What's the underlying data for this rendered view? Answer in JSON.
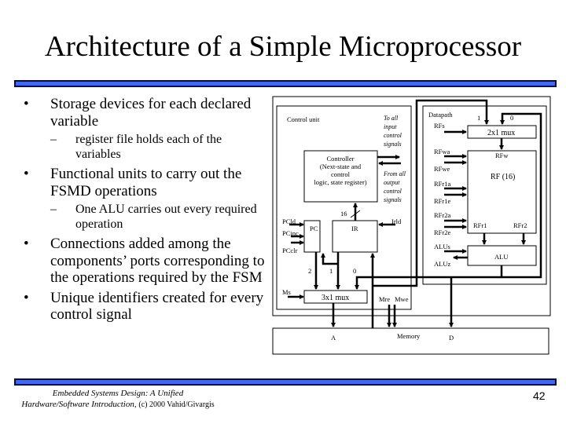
{
  "slide": {
    "title": "Architecture of a Simple Microprocessor",
    "page_number": "42",
    "footer": {
      "line1": "Embedded Systems Design: A Unified",
      "line2_italic": "Hardware/Software Introduction,",
      "line2_plain": "(c) 2000 Vahid/Givargis"
    },
    "accent_color": "#3f69f2"
  },
  "bullets": [
    {
      "level": 1,
      "marker": "•",
      "text": "Storage devices for each declared variable"
    },
    {
      "level": 2,
      "marker": "–",
      "text": "register file holds each of the variables"
    },
    {
      "level": 1,
      "marker": "•",
      "text": "Functional units to carry out the FSMD operations"
    },
    {
      "level": 2,
      "marker": "–",
      "text": "One ALU carries out every required operation"
    },
    {
      "level": 1,
      "marker": "•",
      "text": "Connections added among the components’ ports corresponding to the operations required by the FSM"
    },
    {
      "level": 1,
      "marker": "•",
      "text": "Unique identifiers created for every control signal"
    }
  ],
  "diagram": {
    "control_unit": {
      "label": "Control unit",
      "controller": [
        "Controller",
        "(Next-state and",
        "control",
        "logic, state register)"
      ],
      "to_inputs": [
        "To all",
        "input",
        "control",
        "signals"
      ],
      "from_outputs": [
        "From all",
        "output",
        "control",
        "signals"
      ],
      "bus_width": "16",
      "pc": "PC",
      "ir": "IR",
      "pc_signals": [
        "PCld",
        "PCinc",
        "PCclr"
      ],
      "ir_signal": "Irld",
      "mux3": "3x1 mux",
      "mux3_select": "Ms",
      "mux3_inputs": [
        "2",
        "1",
        "0"
      ]
    },
    "datapath": {
      "label": "Datapath",
      "mux2": "2x1 mux",
      "mux2_inputs": [
        "1",
        "0"
      ],
      "mux2_select": "RFs",
      "rf": "RF (16)",
      "rf_w": "RFw",
      "rf_r1": "RFr1",
      "rf_r2": "RFr2",
      "rf_signals": [
        "RFwa",
        "RFwe",
        "RFr1a",
        "RFr1e",
        "RFr2a",
        "RFr2e"
      ],
      "alu": "ALU",
      "alu_s": "ALUs",
      "alu_z": "ALUz"
    },
    "memory": {
      "label": "Memory",
      "addr": "A",
      "data": "D",
      "signals": [
        "Mre",
        "Mwe"
      ]
    }
  }
}
